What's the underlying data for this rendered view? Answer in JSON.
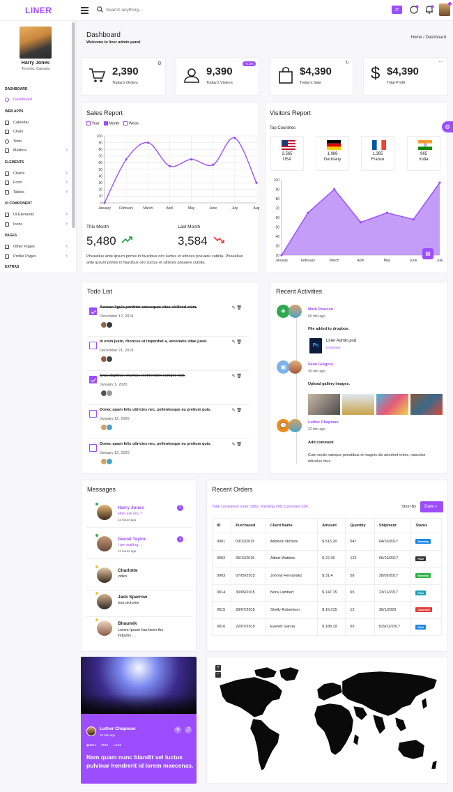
{
  "brand": {
    "logo": "LINER",
    "accent": "#9b4dff"
  },
  "topbar": {
    "search_placeholder": "Search anything..."
  },
  "user": {
    "name": "Harry Jones",
    "location": "Toronto, Canada"
  },
  "sidebar": {
    "sections": [
      {
        "heading": "DASHBOARD",
        "items": [
          {
            "label": "Dashboard",
            "icon": "dashboard-icon",
            "active": true
          }
        ]
      },
      {
        "heading": "WEB APPS",
        "items": [
          {
            "label": "Calendar",
            "icon": "calendar-icon"
          },
          {
            "label": "Chats",
            "icon": "chat-icon"
          },
          {
            "label": "Todo",
            "icon": "todo-icon"
          },
          {
            "label": "Mailbox",
            "icon": "mail-icon",
            "has_children": true
          }
        ]
      },
      {
        "heading": "ELEMENTS",
        "items": [
          {
            "label": "Charts",
            "icon": "chart-icon",
            "has_children": true
          },
          {
            "label": "Form",
            "icon": "form-icon",
            "has_children": true
          },
          {
            "label": "Tables",
            "icon": "table-icon",
            "has_children": true
          }
        ]
      },
      {
        "heading": "UI COMPONENT",
        "items": [
          {
            "label": "UI Elements",
            "icon": "ui-icon",
            "has_children": true
          },
          {
            "label": "Icons",
            "icon": "icons-icon",
            "has_children": true
          }
        ]
      },
      {
        "heading": "PAGES",
        "items": [
          {
            "label": "Other Pages",
            "icon": "pages-icon",
            "has_children": true
          },
          {
            "label": "Profile Pages",
            "icon": "profile-icon",
            "has_children": true
          }
        ]
      },
      {
        "heading": "EXTRAS",
        "items": []
      }
    ]
  },
  "page": {
    "title": "Dashboard",
    "subtitle": "Welcome to liner admin panel",
    "breadcrumb_home": "Home",
    "breadcrumb_sep": "/",
    "breadcrumb_current": "Dashboard"
  },
  "stats": [
    {
      "value": "2,390",
      "label": "Today's Orders",
      "icon": "cart-icon"
    },
    {
      "value": "9,390",
      "label": "Today's Visitors",
      "icon": "user-icon",
      "badge": "+4.3%"
    },
    {
      "value": "$4,390",
      "label": "Today's Sale",
      "icon": "bag-icon"
    },
    {
      "value": "$4,390",
      "label": "Total Profit",
      "icon": "dollar-icon"
    }
  ],
  "sales": {
    "title": "Sales Report",
    "tabs": [
      "Year",
      "Month",
      "Week"
    ],
    "tab_checked": [
      false,
      true,
      false
    ],
    "this_month_label": "This Month",
    "this_month_value": "5,480",
    "last_month_label": "Last Month",
    "last_month_value": "3,584",
    "desc": "Phasellus ante ipsum primis in faucibus orci luctus et ultrices posuere cubilia. Phasellus ante ipsum primis in faucibus orci luctus et ultrices posuere cubilia.",
    "up_color": "#1a9e3c",
    "down_color": "#e03a3a"
  },
  "visitors": {
    "title": "Visitors Report",
    "top_countries": "Top Countries",
    "countries": [
      {
        "count": "2,565",
        "name": "USA"
      },
      {
        "count": "1,986",
        "name": "Germany"
      },
      {
        "count": "1,365",
        "name": "France"
      },
      {
        "count": "965",
        "name": "India"
      }
    ]
  },
  "chart_data": [
    {
      "type": "line",
      "title": "Sales Report",
      "categories": [
        "January",
        "February",
        "March",
        "April",
        "May",
        "June",
        "July",
        "Aug"
      ],
      "values": [
        0,
        65,
        90,
        55,
        65,
        57,
        97,
        30
      ],
      "ylim": [
        0,
        100
      ],
      "yticks": [
        0,
        10,
        20,
        30,
        40,
        50,
        60,
        70,
        80,
        90,
        100
      ],
      "grid": true,
      "color": "#9b4dff"
    },
    {
      "type": "area",
      "title": "Visitors Report",
      "categories": [
        "January",
        "February",
        "March",
        "April",
        "May",
        "June",
        "July"
      ],
      "values": [
        20,
        65,
        90,
        55,
        65,
        58,
        97
      ],
      "ylim": [
        20,
        100
      ],
      "yticks": [
        20,
        30,
        40,
        50,
        60,
        70,
        80,
        90,
        100
      ],
      "grid": false,
      "color": "#9b4dff"
    }
  ],
  "todo": {
    "title": "Todo List",
    "items": [
      {
        "text": "Aenean ligula porttitor consequat vitae eleifend enim.",
        "date": "December 12, 2019",
        "done": true
      },
      {
        "text": "In enim justo, rhoncus ut imperdiet a, venenatis vitae justo.",
        "date": "December 21, 2019",
        "done": false
      },
      {
        "text": "Cras dapibus vivamus elementum semper nisi.",
        "date": "January 1, 2020",
        "done": true
      },
      {
        "text": "Donec quam felis ultricies nec, pellentesque eu pretium quis.",
        "date": "January 12, 2020",
        "done": false
      },
      {
        "text": "Donec quam felis ultricies nec, pellentesque eu pretium quis.",
        "date": "January 12, 2020",
        "done": false
      }
    ]
  },
  "activities": {
    "title": "Recent Activities",
    "items": [
      {
        "name": "Mark Pearson",
        "time": "60 min ago",
        "text": "File added to dropbox.",
        "file": "Liner Admin.psd",
        "file_action": "Download",
        "file_type": "Ps"
      },
      {
        "name": "Sean Gregory",
        "time": "30 min ago",
        "text": "Upload gallery images."
      },
      {
        "name": "Luther Chapman",
        "time": "22 min ago",
        "text": "Add comment",
        "comment": "Cum sociis natoque penatibus et magnis dis arturient ontes, nascetur ridiculus mus."
      }
    ]
  },
  "messages": {
    "title": "Messages",
    "items": [
      {
        "name": "Harry Jones",
        "text": "How are you ?",
        "time": "23 hours ago",
        "badge": "3",
        "dot": "#2fb344",
        "highlight": true
      },
      {
        "name": "Daniel Taylor",
        "text": "I am waiting ...",
        "time": "14 hours ago",
        "badge": "1",
        "dot": "#2fb344",
        "highlight": true
      },
      {
        "name": "Charlotte",
        "text": "video",
        "time": "",
        "badge": "",
        "dot": "#f4c430",
        "highlight": false
      },
      {
        "name": "Jack Sparrow",
        "text": "tour pictures",
        "time": "",
        "badge": "",
        "dot": "#f4c430",
        "highlight": false
      },
      {
        "name": "Bhaumik",
        "text": "Lorem Ipsum has been the industry ...",
        "time": "",
        "badge": "",
        "dot": "#f4c430",
        "highlight": false
      }
    ]
  },
  "orders": {
    "title": "Recent Orders",
    "summary": "Total completed order 1982, Panding 768, Canceled 234.",
    "sort_label": "Short By",
    "sort_value": "Date",
    "columns": [
      "ID",
      "Purchased",
      "Client Name",
      "Amount",
      "Quantity",
      "Shipment",
      "Status"
    ],
    "rows": [
      [
        "0001",
        "03/11/2015",
        "Addison Nichols",
        "$ 515.20",
        "547",
        "04/10/2017",
        "Standby"
      ],
      [
        "0002",
        "05/11/2015",
        "Albert Watkins",
        "$ 22.30",
        "122",
        "06/10/2017",
        "Paid"
      ],
      [
        "0003",
        "07/09/2015",
        "Johnny Fernandez",
        "$ 31.4",
        "58",
        "28/09/2017",
        "Standby"
      ],
      [
        "0014",
        "30/09/2015",
        "Nora Lambert",
        "$ 147.15",
        "65",
        "23/11/2017",
        "Paid"
      ],
      [
        "0015",
        "29/07/2015",
        "Shelly Robertson",
        "$ 15.015",
        "12",
        "30/1/2020",
        "Canceled"
      ],
      [
        "0016",
        "22/07/2015",
        "Everett Garcia",
        "$ 188.19",
        "55",
        "029/11/2017",
        "Paid"
      ]
    ],
    "status_colors": [
      "#1e88e5",
      "#333333",
      "#2fb344",
      "#17a2b8",
      "#e03a3a",
      "#1e88e5"
    ]
  },
  "profile_card": {
    "name": "Luther Chapman",
    "time": "15 min ago",
    "views": "4241",
    "likes": "543",
    "comments": "123",
    "quote": "Nam quam nunc blandit vel luctus pulvinar hendrerit id lorem maecenas."
  },
  "map": {
    "zoom_in": "+",
    "zoom_out": "−"
  }
}
